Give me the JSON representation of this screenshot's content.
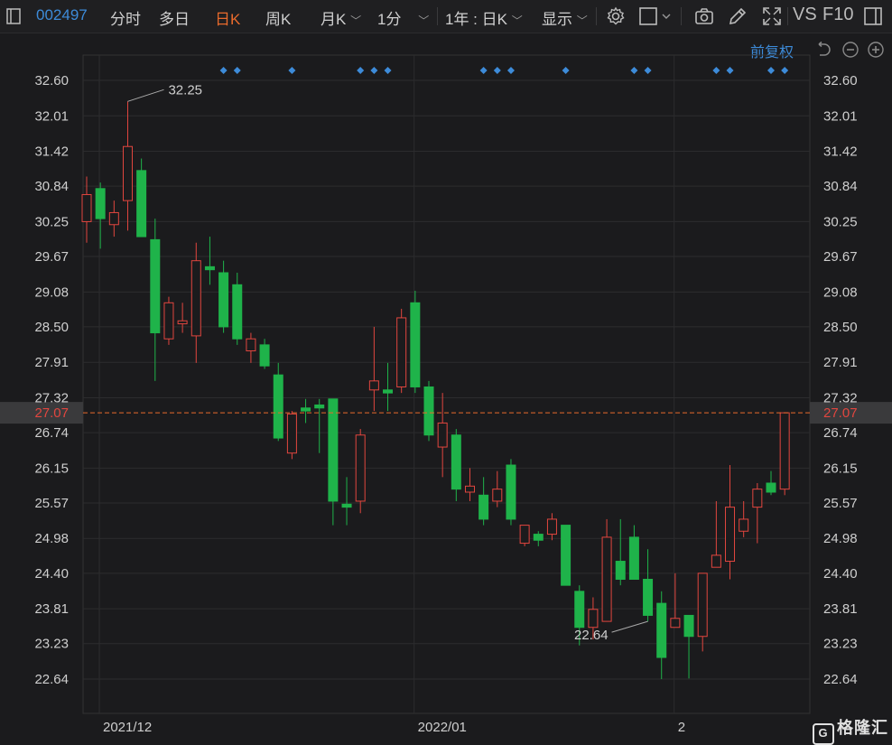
{
  "toolbar": {
    "stock_code": "002497",
    "tabs": [
      "分时",
      "多日",
      "日K",
      "周K"
    ],
    "active_tab": "日K",
    "month_select": "月K",
    "minute_select": "1分",
    "range_select": "1年 : 日K",
    "display_select": "显示",
    "vs": "VS",
    "f10": "F10"
  },
  "adjust_label": "前复权",
  "icons": [
    "panel-toggle-icon",
    "settings-gear-icon",
    "box-select-icon",
    "camera-icon",
    "pen-icon",
    "fullscreen-icon",
    "sidebar-icon",
    "undo-icon",
    "zoom-out-icon",
    "zoom-in-icon"
  ],
  "watermark": "格隆汇",
  "colors": {
    "up": "#e2463f",
    "down": "#1fb34a",
    "accent": "#3d8bd9",
    "active": "#e86a2c",
    "price_line": "#e86a2c"
  },
  "chart_data": {
    "type": "candlestick",
    "y_ticks": [
      "32.60",
      "32.01",
      "31.42",
      "30.84",
      "30.25",
      "29.67",
      "29.08",
      "28.50",
      "27.91",
      "27.32",
      "26.74",
      "26.15",
      "25.57",
      "24.98",
      "24.40",
      "23.81",
      "23.23",
      "22.64"
    ],
    "ylim": [
      22.64,
      32.6
    ],
    "x_labels": [
      {
        "index": 0,
        "label": "2021/12"
      },
      {
        "index": 23,
        "label": "2022/01"
      },
      {
        "index": 42,
        "label": "2"
      }
    ],
    "current_price": "27.07",
    "high_annotation": {
      "index": 3,
      "label": "32.25"
    },
    "low_annotation": {
      "index": 41,
      "label": "22.64"
    },
    "event_marker_indices": [
      10,
      11,
      15,
      20,
      21,
      22,
      29,
      30,
      31,
      35,
      40,
      41,
      46,
      47,
      50,
      51
    ],
    "candles": [
      {
        "o": 30.25,
        "h": 31.0,
        "l": 29.9,
        "c": 30.7
      },
      {
        "o": 30.8,
        "h": 30.9,
        "l": 29.8,
        "c": 30.3
      },
      {
        "o": 30.2,
        "h": 30.6,
        "l": 30.0,
        "c": 30.4
      },
      {
        "o": 30.6,
        "h": 32.25,
        "l": 30.1,
        "c": 31.5
      },
      {
        "o": 31.1,
        "h": 31.3,
        "l": 30.0,
        "c": 30.0
      },
      {
        "o": 29.95,
        "h": 30.3,
        "l": 27.6,
        "c": 28.4
      },
      {
        "o": 28.3,
        "h": 29.0,
        "l": 28.2,
        "c": 28.9
      },
      {
        "o": 28.55,
        "h": 28.9,
        "l": 28.4,
        "c": 28.6
      },
      {
        "o": 28.35,
        "h": 29.9,
        "l": 27.9,
        "c": 29.6
      },
      {
        "o": 29.5,
        "h": 30.0,
        "l": 29.2,
        "c": 29.45
      },
      {
        "o": 29.4,
        "h": 29.6,
        "l": 28.4,
        "c": 28.5
      },
      {
        "o": 29.2,
        "h": 29.4,
        "l": 28.2,
        "c": 28.3
      },
      {
        "o": 28.1,
        "h": 28.4,
        "l": 27.9,
        "c": 28.3
      },
      {
        "o": 28.2,
        "h": 28.3,
        "l": 27.8,
        "c": 27.85
      },
      {
        "o": 27.7,
        "h": 27.9,
        "l": 26.6,
        "c": 26.65
      },
      {
        "o": 26.4,
        "h": 27.1,
        "l": 26.3,
        "c": 27.05
      },
      {
        "o": 27.15,
        "h": 27.3,
        "l": 26.9,
        "c": 27.1
      },
      {
        "o": 27.2,
        "h": 27.3,
        "l": 26.4,
        "c": 27.15
      },
      {
        "o": 27.3,
        "h": 27.3,
        "l": 25.2,
        "c": 25.6
      },
      {
        "o": 25.55,
        "h": 26.0,
        "l": 25.2,
        "c": 25.5
      },
      {
        "o": 25.6,
        "h": 26.8,
        "l": 25.4,
        "c": 26.7
      },
      {
        "o": 27.45,
        "h": 28.5,
        "l": 27.1,
        "c": 27.6
      },
      {
        "o": 27.45,
        "h": 27.9,
        "l": 27.1,
        "c": 27.4
      },
      {
        "o": 27.5,
        "h": 28.8,
        "l": 27.4,
        "c": 28.65
      },
      {
        "o": 28.9,
        "h": 29.1,
        "l": 27.4,
        "c": 27.5
      },
      {
        "o": 27.5,
        "h": 27.6,
        "l": 26.6,
        "c": 26.7
      },
      {
        "o": 26.5,
        "h": 27.4,
        "l": 26.0,
        "c": 26.9
      },
      {
        "o": 26.7,
        "h": 26.8,
        "l": 25.6,
        "c": 25.8
      },
      {
        "o": 25.75,
        "h": 26.15,
        "l": 25.6,
        "c": 25.85
      },
      {
        "o": 25.7,
        "h": 26.0,
        "l": 25.2,
        "c": 25.3
      },
      {
        "o": 25.6,
        "h": 26.1,
        "l": 25.5,
        "c": 25.8
      },
      {
        "o": 26.2,
        "h": 26.3,
        "l": 25.2,
        "c": 25.3
      },
      {
        "o": 24.9,
        "h": 25.2,
        "l": 24.85,
        "c": 25.2
      },
      {
        "o": 25.05,
        "h": 25.1,
        "l": 24.85,
        "c": 24.95
      },
      {
        "o": 25.05,
        "h": 25.4,
        "l": 24.95,
        "c": 25.3
      },
      {
        "o": 25.2,
        "h": 25.2,
        "l": 24.2,
        "c": 24.2
      },
      {
        "o": 24.1,
        "h": 24.2,
        "l": 23.2,
        "c": 23.5
      },
      {
        "o": 23.5,
        "h": 24.0,
        "l": 23.3,
        "c": 23.8
      },
      {
        "o": 23.6,
        "h": 25.3,
        "l": 23.6,
        "c": 25.0
      },
      {
        "o": 24.6,
        "h": 25.3,
        "l": 24.2,
        "c": 24.3
      },
      {
        "o": 25.0,
        "h": 25.2,
        "l": 24.3,
        "c": 24.3
      },
      {
        "o": 24.3,
        "h": 24.8,
        "l": 23.6,
        "c": 23.7
      },
      {
        "o": 23.9,
        "h": 24.1,
        "l": 22.64,
        "c": 23.0
      },
      {
        "o": 23.5,
        "h": 24.4,
        "l": 23.5,
        "c": 23.65
      },
      {
        "o": 23.7,
        "h": 23.7,
        "l": 22.65,
        "c": 23.35
      },
      {
        "o": 23.35,
        "h": 24.4,
        "l": 23.1,
        "c": 24.4
      },
      {
        "o": 24.5,
        "h": 25.6,
        "l": 24.5,
        "c": 24.7
      },
      {
        "o": 24.6,
        "h": 26.2,
        "l": 24.3,
        "c": 25.5
      },
      {
        "o": 25.1,
        "h": 25.6,
        "l": 25.0,
        "c": 25.3
      },
      {
        "o": 25.5,
        "h": 25.9,
        "l": 24.9,
        "c": 25.8
      },
      {
        "o": 25.9,
        "h": 26.1,
        "l": 25.7,
        "c": 25.75
      },
      {
        "o": 25.8,
        "h": 27.07,
        "l": 25.7,
        "c": 27.07
      }
    ]
  }
}
